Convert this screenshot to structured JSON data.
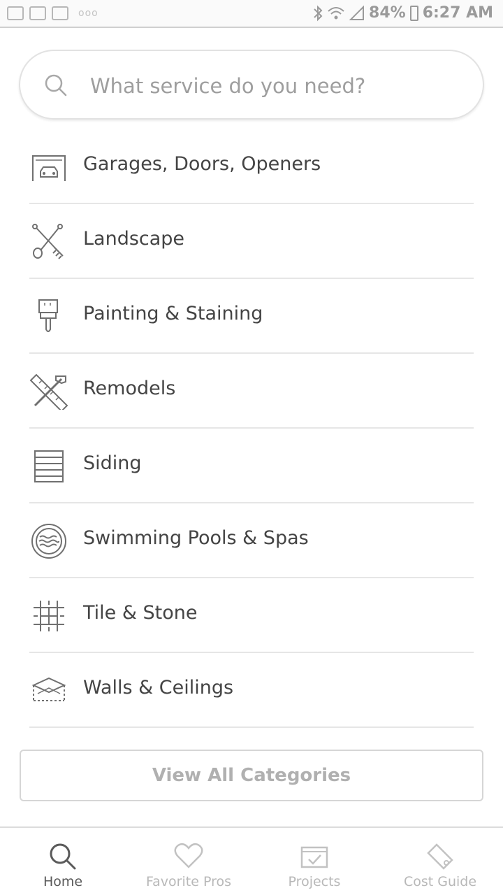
{
  "status_bar": {
    "notification_icons": [
      "gallery-icon",
      "check-mail-icon",
      "gmail-icon"
    ],
    "overflow": "ooo",
    "battery": "84%",
    "time": "6:27 AM"
  },
  "search": {
    "placeholder": "What service do you need?"
  },
  "categories": [
    {
      "label": "Garages, Doors, Openers",
      "icon": "garage-icon"
    },
    {
      "label": "Landscape",
      "icon": "shovel-rake-icon"
    },
    {
      "label": "Painting & Staining",
      "icon": "paintbrush-icon"
    },
    {
      "label": "Remodels",
      "icon": "hammer-ruler-icon"
    },
    {
      "label": "Siding",
      "icon": "siding-icon"
    },
    {
      "label": "Swimming Pools & Spas",
      "icon": "pool-icon"
    },
    {
      "label": "Tile & Stone",
      "icon": "tile-icon"
    },
    {
      "label": "Walls & Ceilings",
      "icon": "walls-ceilings-icon"
    }
  ],
  "view_all_label": "View All Categories",
  "bottom_nav": [
    {
      "label": "Home",
      "icon": "search-icon",
      "active": true
    },
    {
      "label": "Favorite Pros",
      "icon": "heart-icon",
      "active": false
    },
    {
      "label": "Projects",
      "icon": "projects-icon",
      "active": false
    },
    {
      "label": "Cost Guide",
      "icon": "tag-icon",
      "active": false
    }
  ]
}
